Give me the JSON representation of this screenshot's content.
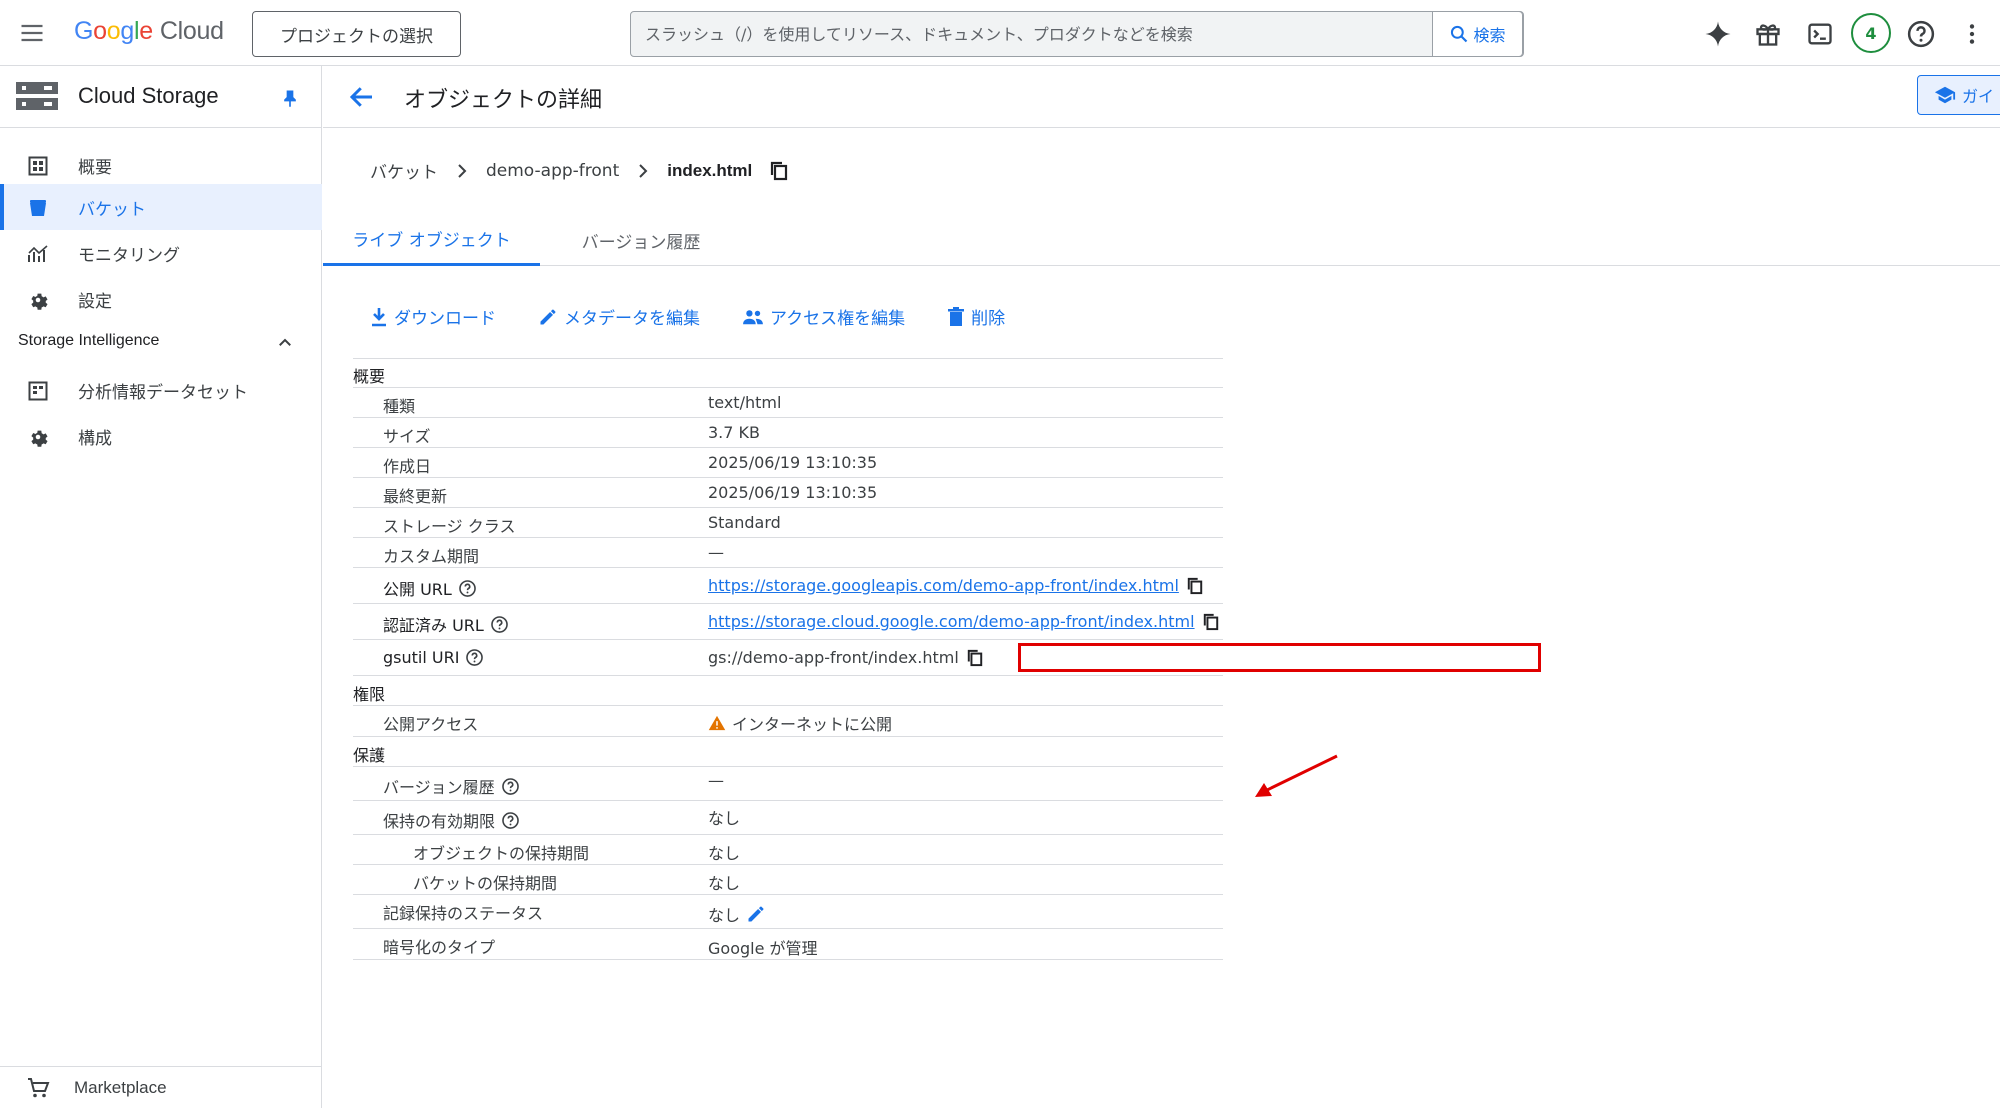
{
  "topbar": {
    "logo_google": [
      "G",
      "o",
      "o",
      "g",
      "l",
      "e"
    ],
    "logo_cloud": "Cloud",
    "project_button": "プロジェクトの選択",
    "search_placeholder": "スラッシュ（/）を使用してリソース、ドキュメント、プロダクトなどを検索",
    "search_button": "検索",
    "notification_count": "4",
    "icons": [
      "menu-icon",
      "gemini-sparkle-icon",
      "gift-icon",
      "terminal-icon",
      "help-icon",
      "more-vert-icon"
    ]
  },
  "sidebar": {
    "title": "Cloud Storage",
    "items": [
      {
        "label": "概要",
        "icon": "overview-icon"
      },
      {
        "label": "バケット",
        "icon": "bucket-icon",
        "active": true
      },
      {
        "label": "モニタリング",
        "icon": "monitoring-icon"
      },
      {
        "label": "設定",
        "icon": "settings-icon"
      }
    ],
    "section_title": "Storage Intelligence",
    "section_items": [
      {
        "label": "分析情報データセット",
        "icon": "dataset-icon"
      },
      {
        "label": "構成",
        "icon": "config-gear-icon"
      }
    ],
    "footer": "Marketplace"
  },
  "main": {
    "title": "オブジェクトの詳細",
    "guide_button": "ガイ",
    "breadcrumb": [
      "バケット",
      "demo-app-front",
      "index.html"
    ],
    "tabs": [
      "ライブ オブジェクト",
      "バージョン履歴"
    ],
    "actions": [
      "ダウンロード",
      "メタデータを編集",
      "アクセス権を編集",
      "削除"
    ],
    "sections": {
      "overview": "概要",
      "permissions": "権限",
      "protection": "保護"
    },
    "rows": {
      "type": {
        "label": "種類",
        "value": "text/html"
      },
      "size": {
        "label": "サイズ",
        "value": "3.7 KB"
      },
      "created": {
        "label": "作成日",
        "value": "2025/06/19 13:10:35"
      },
      "updated": {
        "label": "最終更新",
        "value": "2025/06/19 13:10:35"
      },
      "storage_class": {
        "label": "ストレージ クラス",
        "value": "Standard"
      },
      "custom_time": {
        "label": "カスタム期間",
        "value": "—"
      },
      "public_url": {
        "label": "公開 URL",
        "value": "https://storage.googleapis.com/demo-app-front/index.html"
      },
      "auth_url": {
        "label": "認証済み URL",
        "value": "https://storage.cloud.google.com/demo-app-front/index.html"
      },
      "gsutil_uri": {
        "label": "gsutil URI",
        "value": "gs://demo-app-front/index.html"
      },
      "public_access": {
        "label": "公開アクセス",
        "value": "インターネットに公開"
      },
      "versioning": {
        "label": "バージョン履歴",
        "value": "—"
      },
      "retention_expiry": {
        "label": "保持の有効期限",
        "value": "なし"
      },
      "object_retention": {
        "label": "オブジェクトの保持期間",
        "value": "なし"
      },
      "bucket_retention": {
        "label": "バケットの保持期間",
        "value": "なし"
      },
      "hold_status": {
        "label": "記録保持のステータス",
        "value": "なし"
      },
      "encryption": {
        "label": "暗号化のタイプ",
        "value": "Google が管理"
      }
    }
  },
  "colors": {
    "accent": "#1a73e8",
    "annotation": "#e00000",
    "warning": "#e37400"
  }
}
